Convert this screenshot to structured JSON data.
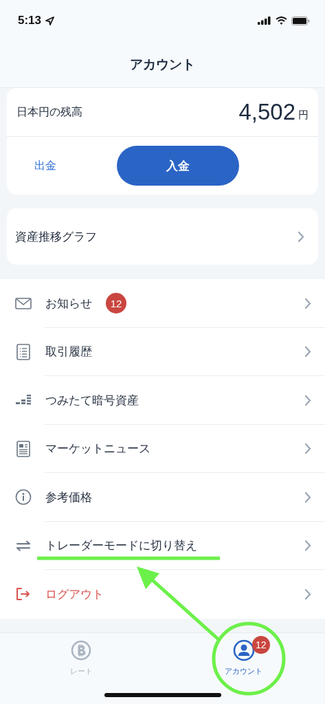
{
  "status_bar": {
    "time": "5:13"
  },
  "header": {
    "title": "アカウント"
  },
  "balance": {
    "label": "日本円の残高",
    "amount": "4,502",
    "unit": "円",
    "withdraw": "出金",
    "deposit": "入金"
  },
  "graph_link": {
    "label": "資産推移グラフ"
  },
  "menu": [
    {
      "label": "お知らせ",
      "kind": "normal",
      "badge": "12"
    },
    {
      "label": "取引履歴",
      "kind": "normal"
    },
    {
      "label": "つみたて暗号資産",
      "kind": "normal"
    },
    {
      "label": "マーケットニュース",
      "kind": "normal"
    },
    {
      "label": "参考価格",
      "kind": "normal"
    },
    {
      "label": "トレーダーモードに切り替え",
      "kind": "normal"
    },
    {
      "label": "ログアウト",
      "kind": "danger"
    }
  ],
  "tab_bar": [
    {
      "label": "レート",
      "selected": false
    },
    {
      "label": "アカウント",
      "selected": true,
      "badge": "12"
    }
  ],
  "annotations": [
    {
      "kind": "underline"
    },
    {
      "kind": "arrow"
    },
    {
      "kind": "circle"
    }
  ]
}
